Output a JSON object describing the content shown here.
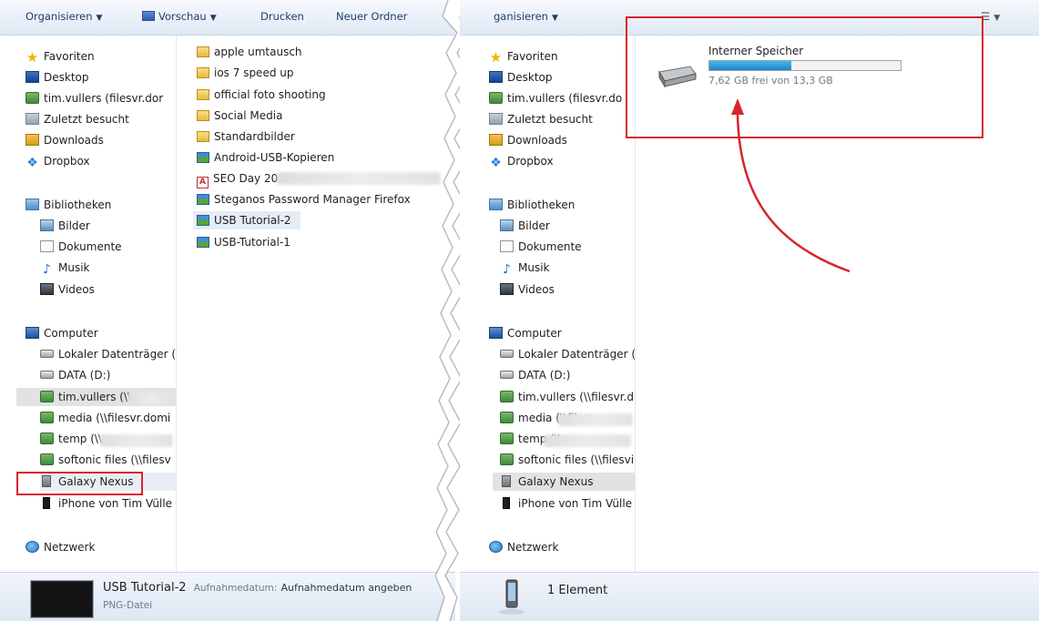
{
  "left": {
    "toolbar": {
      "organize": "Organisieren",
      "preview": "Vorschau",
      "print": "Drucken",
      "new_folder": "Neuer Ordner"
    },
    "nav": {
      "favorites": [
        "Favoriten",
        "Desktop",
        "tim.vullers (filesvr.dor",
        "Zuletzt besucht",
        "Downloads",
        "Dropbox"
      ],
      "libraries": [
        "Bibliotheken",
        "Bilder",
        "Dokumente",
        "Musik",
        "Videos"
      ],
      "computer": [
        "Computer",
        "Lokaler Datenträger (",
        "DATA (D:)",
        "tim.vullers (\\\\",
        "media (\\\\filesvr.domi",
        "temp (\\\\",
        "softonic files (\\\\filesv",
        "Galaxy Nexus",
        "iPhone von Tim Vülle"
      ],
      "network": "Netzwerk"
    },
    "files": [
      "apple umtausch",
      "ios 7 speed up",
      "official foto shooting",
      "Social Media",
      "Standardbilder",
      "Android-USB-Kopieren",
      "SEO Day 2013",
      "Steganos Password Manager Firefox",
      "USB Tutorial-2",
      "USB-Tutorial-1"
    ],
    "status": {
      "filename": "USB Tutorial-2",
      "meta_label": "Aufnahmedatum:",
      "meta_value": "Aufnahmedatum angeben",
      "type": "PNG-Datei"
    }
  },
  "right": {
    "toolbar": {
      "organize": "ganisieren"
    },
    "nav": {
      "favorites": [
        "Favoriten",
        "Desktop",
        "tim.vullers (filesvr.do",
        "Zuletzt besucht",
        "Downloads",
        "Dropbox"
      ],
      "libraries": [
        "Bibliotheken",
        "Bilder",
        "Dokumente",
        "Musik",
        "Videos"
      ],
      "computer": [
        "Computer",
        "Lokaler Datenträger (l",
        "DATA (D:)",
        "tim.vullers (\\\\filesvr.d",
        "media (\\\\filesvr.",
        "temp (\\\\",
        "softonic files (\\\\filesvi",
        "Galaxy Nexus",
        "iPhone von Tim Vülle"
      ],
      "network": "Netzwerk"
    },
    "storage": {
      "name": "Interner Speicher",
      "free_text": "7,62 GB frei von 13,3 GB",
      "used_fraction": 0.43
    },
    "status": {
      "count": "1 Element"
    }
  },
  "colors": {
    "annotation_red": "#d6252b",
    "storage_bar": "#2a9bd6"
  }
}
